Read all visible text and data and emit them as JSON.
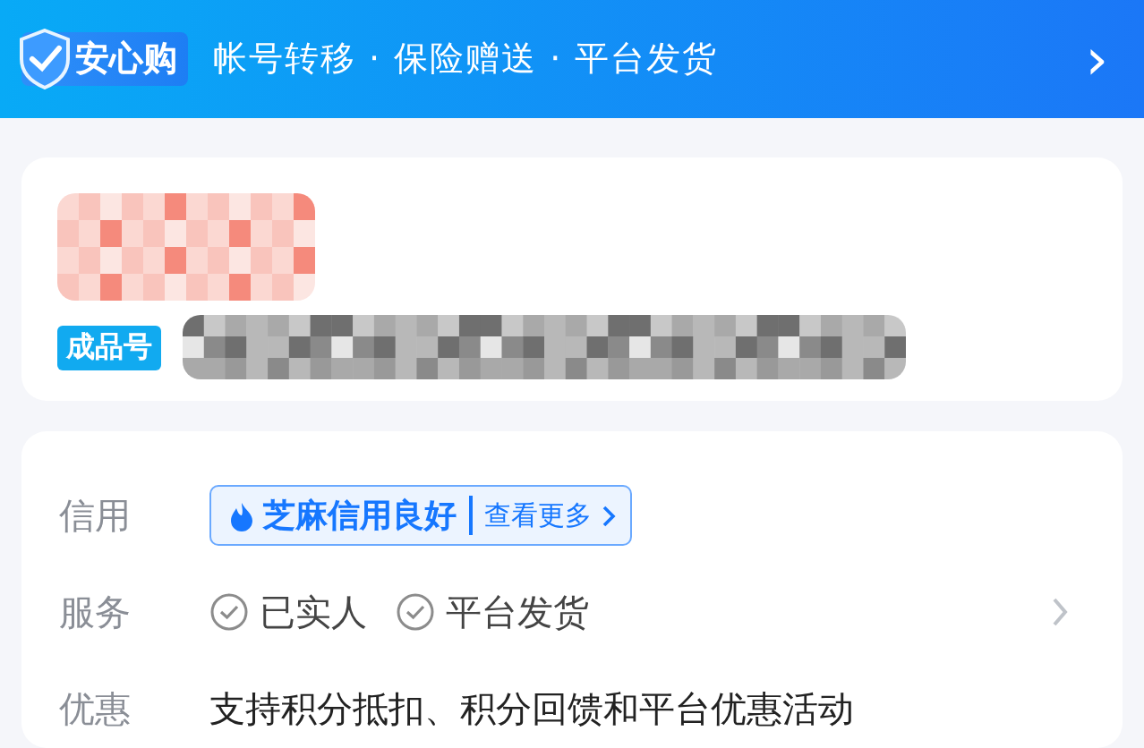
{
  "banner": {
    "badge": "安心购",
    "text": "帐号转移 · 保险赠送 · 平台发货",
    "arrow": "›"
  },
  "product": {
    "tag": "成品号"
  },
  "details": [
    {
      "kind": "credit",
      "label": "信用",
      "value": "芝麻信用良好",
      "link": "查看更多"
    },
    {
      "kind": "services",
      "label": "服务",
      "items": [
        "已实人",
        "平台发货"
      ]
    },
    {
      "kind": "text",
      "label": "优惠",
      "value": "支持积分抵扣、积分回馈和平台优惠活动"
    }
  ]
}
